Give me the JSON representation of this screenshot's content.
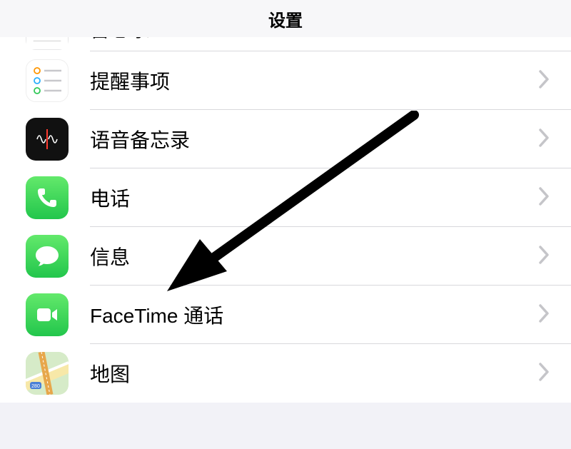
{
  "header": {
    "title": "设置"
  },
  "rows": {
    "memo_partial": {
      "label": "备忘录"
    },
    "reminders": {
      "label": "提醒事项"
    },
    "voice_memos": {
      "label": "语音备忘录"
    },
    "phone": {
      "label": "电话"
    },
    "messages": {
      "label": "信息"
    },
    "facetime": {
      "label": "FaceTime 通话"
    },
    "maps": {
      "label": "地图"
    }
  },
  "annotation": {
    "arrow_target": "messages"
  }
}
